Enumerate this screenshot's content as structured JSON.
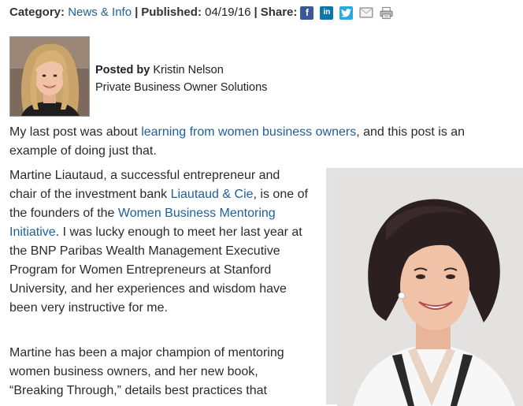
{
  "meta": {
    "category_label": "Category:",
    "category_value": "News & Info",
    "separator": "|",
    "published_label": "Published:",
    "published_value": "04/19/16",
    "share_label": "Share:",
    "share_icons": [
      "facebook-icon",
      "linkedin-icon",
      "twitter-icon",
      "email-icon",
      "print-icon"
    ],
    "fb_glyph": "f",
    "li_glyph": "in"
  },
  "author": {
    "posted_by_label": "Posted by",
    "name": "Kristin Nelson",
    "title": "Private Business Owner Solutions"
  },
  "article": {
    "p1": {
      "before": "My last post was about ",
      "link": "learning from women business owners",
      "after": ", and this post is an example of doing just that."
    },
    "p2": {
      "part1": "Martine Liautaud, a successful entrepreneur and chair of the investment bank ",
      "link1": "Liautaud & Cie",
      "part2": ", is one of the founders of the ",
      "link2": "Women Business Mentoring Initiative",
      "part3": ". I was lucky enough to meet her last year at the BNP Paribas Wealth Management Executive Program for Women Entrepreneurs at Stanford University, and her experiences and wisdom have been very instructive for me."
    },
    "p3": {
      "text": "Martine has been a major champion of mentoring women business owners, and her new book, “Breaking Through,” details best practices that"
    }
  },
  "colors": {
    "link": "#1f5f99",
    "text": "#2a2a2a",
    "facebook": "#3b5998",
    "linkedin": "#0e76a8",
    "twitter": "#2aa9e0"
  }
}
